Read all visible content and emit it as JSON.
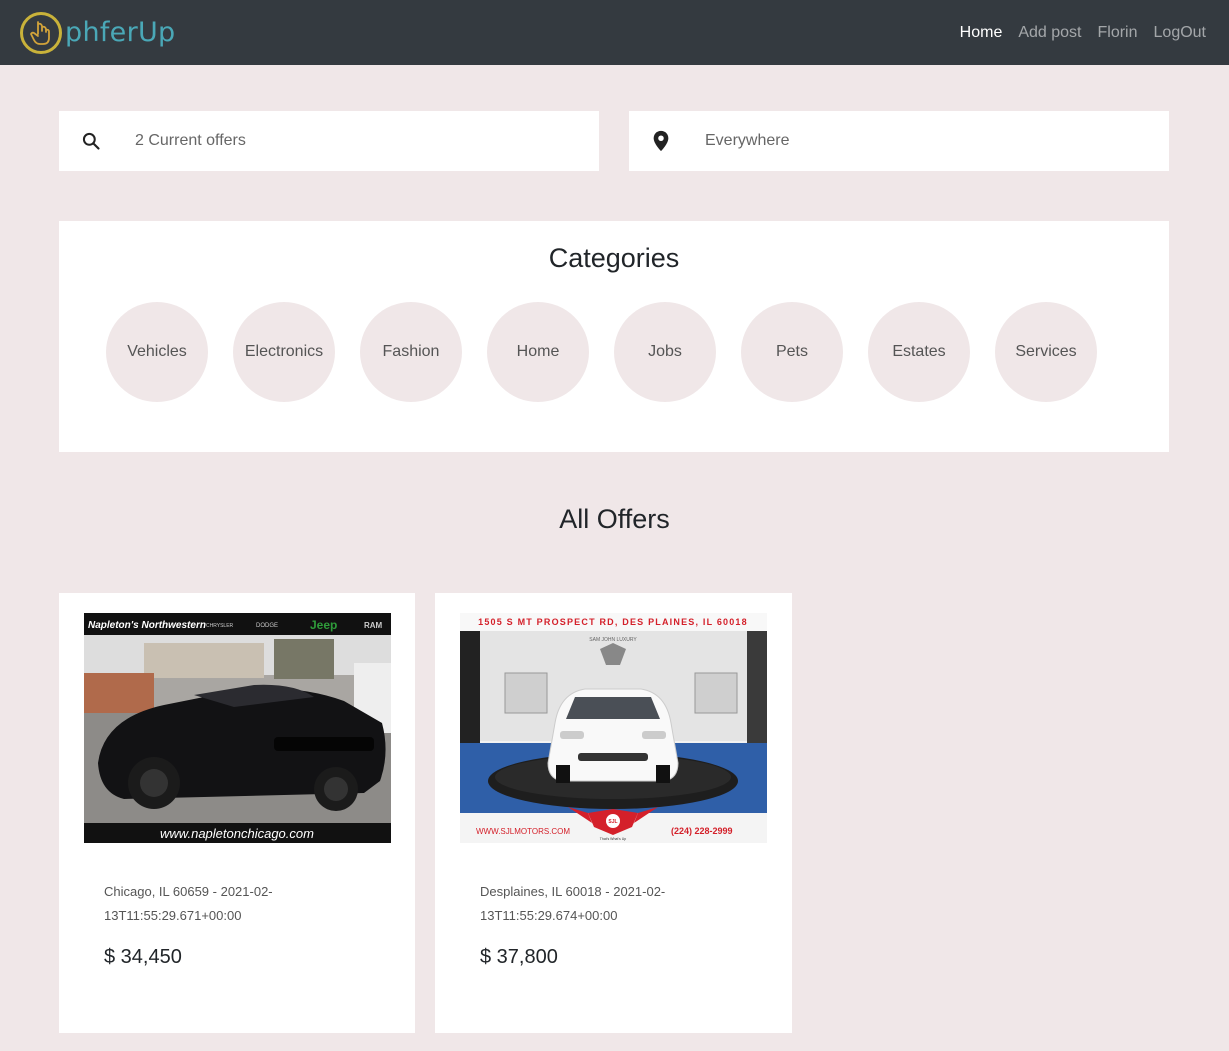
{
  "navbar": {
    "brand_text": "phferUp",
    "links": [
      {
        "label": "Home",
        "active": true
      },
      {
        "label": "Add post",
        "active": false
      },
      {
        "label": "Florin",
        "active": false
      },
      {
        "label": "LogOut",
        "active": false
      }
    ]
  },
  "search": {
    "query_placeholder": "2 Current offers",
    "location_placeholder": "Everywhere"
  },
  "categories": {
    "title": "Categories",
    "items": [
      "Vehicles",
      "Electronics",
      "Fashion",
      "Home",
      "Jobs",
      "Pets",
      "Estates",
      "Services"
    ]
  },
  "offers": {
    "title": "All Offers",
    "items": [
      {
        "location_date": "Chicago, IL 60659 - 2021-02-13T11:55:29.671+00:00",
        "price": "$ 34,450",
        "image": {
          "top_banner": "Napleton's Northwestern",
          "brands": [
            "CHRYSLER",
            "DODGE",
            "Jeep",
            "RAM"
          ],
          "bottom_banner": "www.napletonchicago.com"
        }
      },
      {
        "location_date": "Desplaines, IL 60018 - 2021-02-13T11:55:29.674+00:00",
        "price": "$ 37,800",
        "image": {
          "top_banner": "1505 S MT PROSPECT RD, DES PLAINES, IL 60018",
          "logo_text": "SAM JOHN LUXURY",
          "website": "WWW.SJLMOTORS.COM",
          "phone": "(224) 228-2999",
          "badge": "SJL",
          "slogan": "That's What's Up"
        }
      }
    ]
  },
  "colors": {
    "page_bg": "#f0e7e8",
    "navbar_bg": "#343a40",
    "brand_teal": "#4aa8b7",
    "brand_gold": "#c9b23a"
  }
}
